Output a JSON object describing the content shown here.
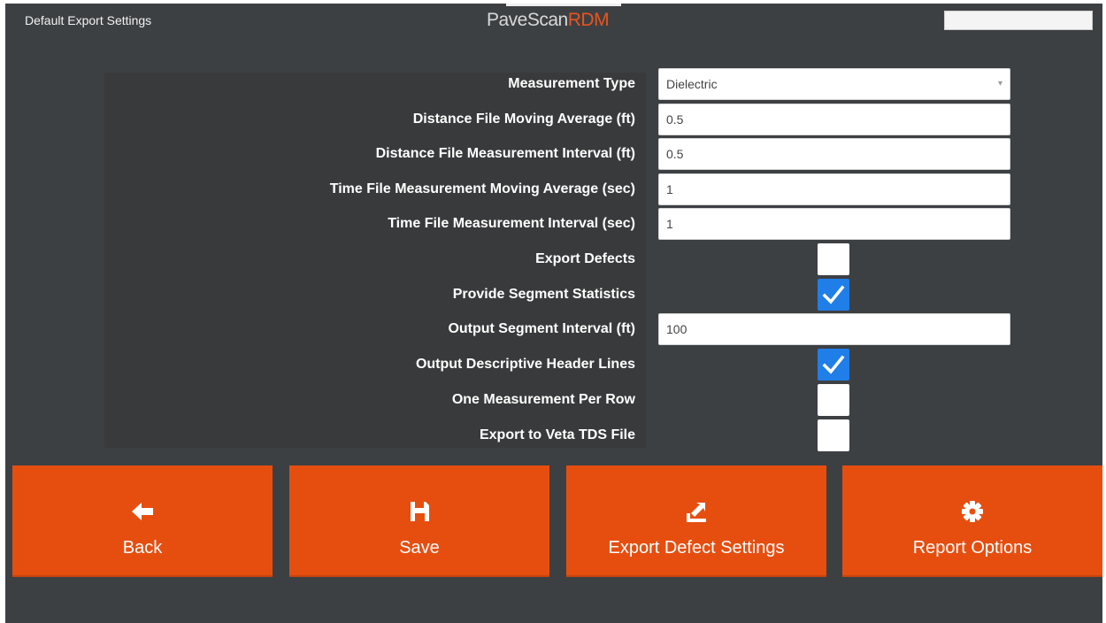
{
  "window": {
    "title": "Default Export Settings",
    "brand_main": "PaveScan",
    "brand_accent": "RDM"
  },
  "form": {
    "measurement_type": {
      "label": "Measurement Type",
      "value": "Dielectric"
    },
    "distance_moving_average": {
      "label": "Distance File Moving Average (ft)",
      "value": "0.5"
    },
    "distance_interval": {
      "label": "Distance File Measurement Interval (ft)",
      "value": "0.5"
    },
    "time_moving_average": {
      "label": "Time File Measurement Moving Average (sec)",
      "value": "1"
    },
    "time_interval": {
      "label": "Time File Measurement Interval (sec)",
      "value": "1"
    },
    "export_defects": {
      "label": "Export Defects",
      "checked": false
    },
    "segment_statistics": {
      "label": "Provide Segment Statistics",
      "checked": true
    },
    "segment_interval": {
      "label": "Output Segment Interval (ft)",
      "value": "100"
    },
    "descriptive_header": {
      "label": "Output Descriptive Header Lines",
      "checked": true
    },
    "one_per_row": {
      "label": "One Measurement Per Row",
      "checked": false
    },
    "veta_tds": {
      "label": "Export to Veta TDS File",
      "checked": false
    }
  },
  "actions": {
    "back": {
      "label": "Back",
      "icon": "arrow-left-icon"
    },
    "save": {
      "label": "Save",
      "icon": "save-icon"
    },
    "export_defect_settings": {
      "label": "Export Defect Settings",
      "icon": "export-icon"
    },
    "report_options": {
      "label": "Report Options",
      "icon": "gear-icon"
    }
  },
  "colors": {
    "background": "#3d4043",
    "accent": "#e64e10",
    "checkbox_checked": "#1f7ee8"
  }
}
